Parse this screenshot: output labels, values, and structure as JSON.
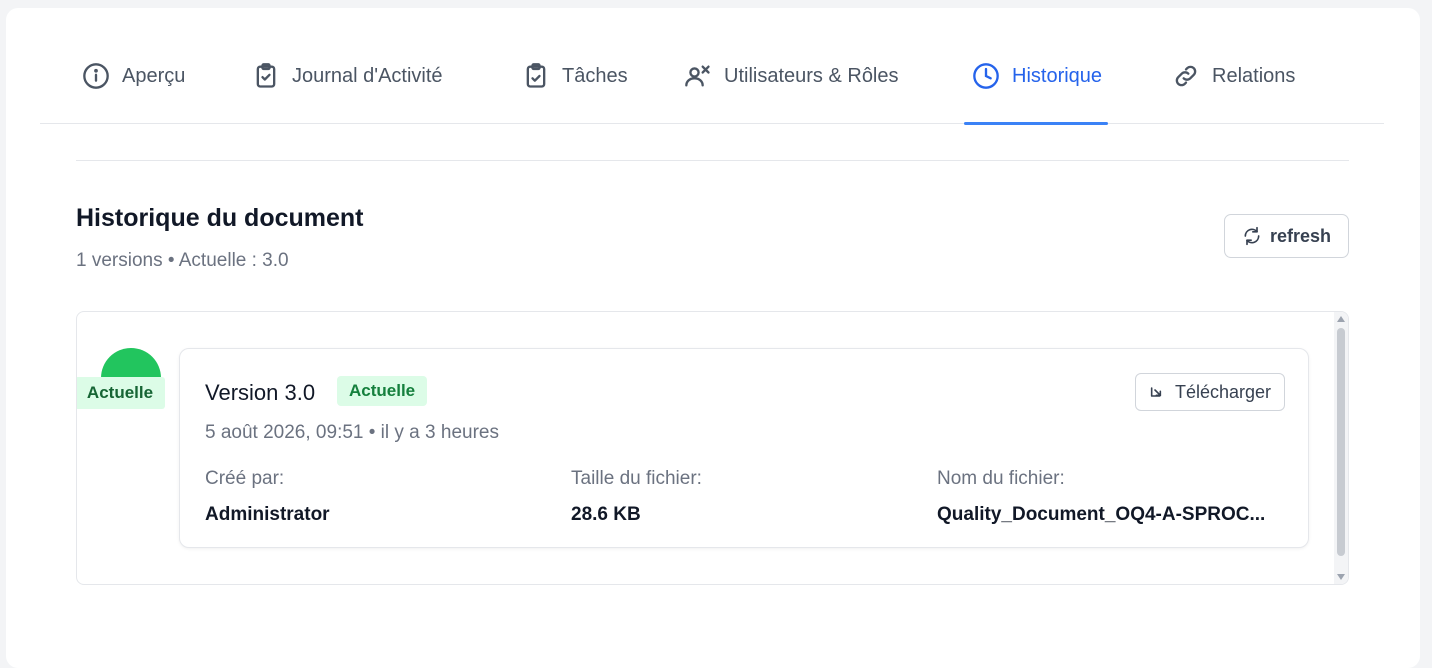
{
  "tabs": [
    {
      "label": "Aperçu",
      "icon": "info-icon"
    },
    {
      "label": "Journal d'Activité",
      "icon": "clipboard-icon"
    },
    {
      "label": "Tâches",
      "icon": "clipboard-check-icon"
    },
    {
      "label": "Utilisateurs & Rôles",
      "icon": "users-icon"
    },
    {
      "label": "Historique",
      "icon": "clock-icon",
      "active": true
    },
    {
      "label": "Relations",
      "icon": "link-icon"
    }
  ],
  "history": {
    "title": "Historique du document",
    "subtitle": "1 versions • Actuelle : 3.0",
    "refresh_label": "refresh"
  },
  "version": {
    "timeline_badge": "Actuelle",
    "title": "Version 3.0",
    "badge": "Actuelle",
    "date": "5 août 2026, 09:51 • il y a 3 heures",
    "download_label": "Télécharger",
    "created_by_label": "Créé par:",
    "created_by": "Administrator",
    "size_label": "Taille du fichier:",
    "size": "28.6 KB",
    "filename_label": "Nom du fichier:",
    "filename": "Quality_Document_OQ4-A-SPROC..."
  },
  "colors": {
    "accent": "#2563eb",
    "success": "#22c55e",
    "success_bg": "#dcfce7"
  }
}
